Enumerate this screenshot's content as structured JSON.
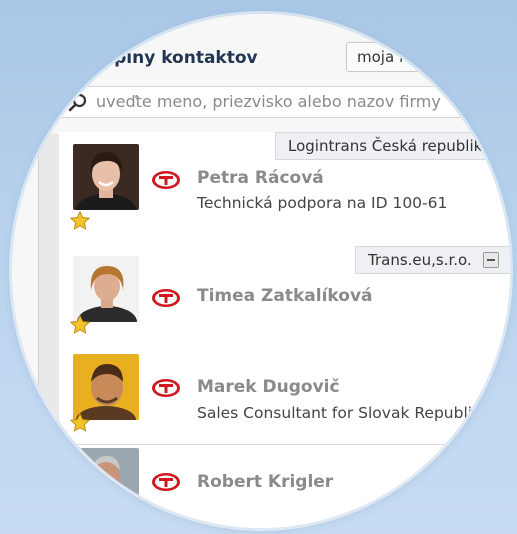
{
  "header": {
    "title": "upiny kontaktov",
    "tab_label": "moja fi..."
  },
  "search": {
    "placeholder": "uveďte meno, priezvisko alebo nazov firmy",
    "icon": "search-icon"
  },
  "contacts": [
    {
      "company": "Logintrans Česká republik",
      "name": "Petra Rácová",
      "role": "Technická podpora na ID 100-61",
      "favorite": true,
      "badge": "trans-logo-icon"
    },
    {
      "company": "Trans.eu,s.r.o.",
      "name": "Timea Zatkalíková",
      "role": "",
      "favorite": true,
      "badge": "trans-logo-icon"
    },
    {
      "company": "",
      "name": "Marek Dugovič",
      "role": "Sales Consultant for Slovak Republic",
      "favorite": true,
      "badge": "trans-logo-icon"
    },
    {
      "company": "",
      "name": "Robert Krigler",
      "role": "",
      "favorite": false,
      "badge": "trans-logo-icon"
    }
  ],
  "colors": {
    "background": "#b9d3ee",
    "title": "#1f3550",
    "badge_red": "#d1181e",
    "star_gold": "#f4c22b",
    "name_gray": "#8a8a8a"
  }
}
